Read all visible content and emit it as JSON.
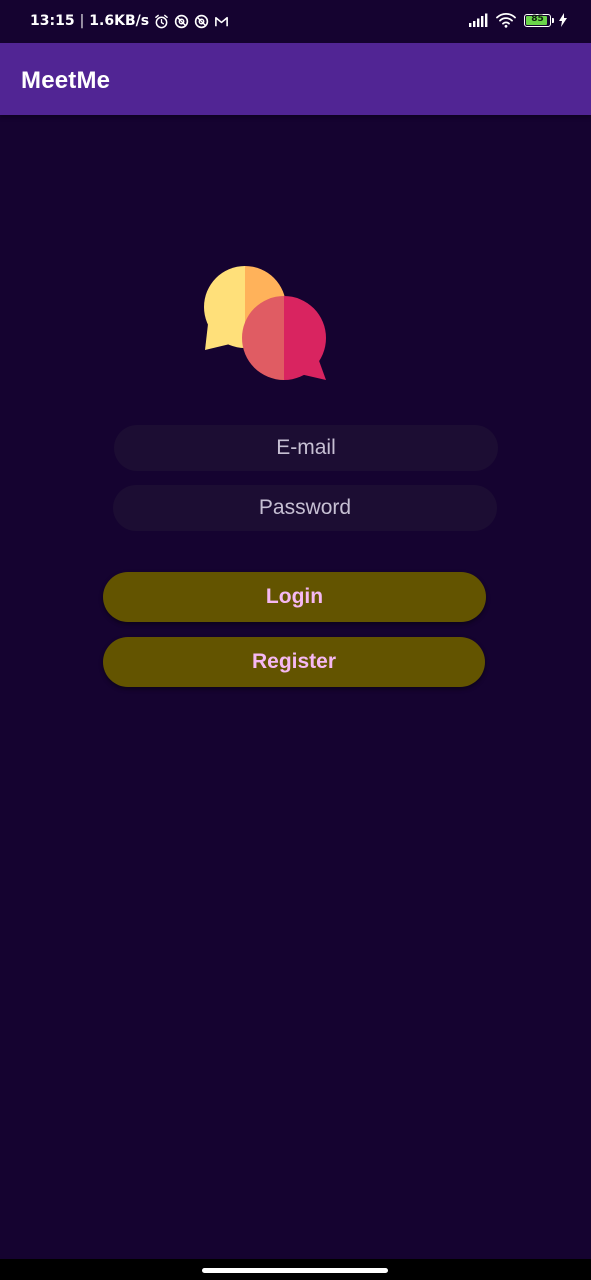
{
  "status_bar": {
    "time": "13:15",
    "separator": "|",
    "net_speed": "1.6KB/s",
    "icons": [
      "alarm-icon",
      "blocked-icon",
      "blocked-icon",
      "gmail-icon"
    ],
    "battery_level": "85",
    "right_icons": [
      "signal-icon",
      "wifi-icon",
      "battery-icon",
      "charging-icon"
    ]
  },
  "app_bar": {
    "title": "MeetMe",
    "color": "#512594"
  },
  "logo": {
    "icon": "chat-bubbles-icon",
    "colors": [
      "#ffe07a",
      "#ffb25a",
      "#e05c63",
      "#d92460"
    ]
  },
  "form": {
    "email_placeholder": "E-mail",
    "password_placeholder": "Password",
    "email_value": "",
    "password_value": ""
  },
  "buttons": {
    "login_label": "Login",
    "register_label": "Register",
    "background": "#635400",
    "text_color": "#f5b8f2"
  },
  "theme": {
    "background": "#150330"
  }
}
